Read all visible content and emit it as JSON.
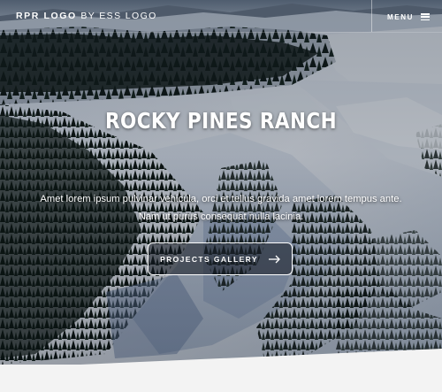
{
  "header": {
    "logo_bold": "RPR LOGO",
    "logo_light": "BY ESS LOGO",
    "menu_label": "MENU"
  },
  "hero": {
    "title": "ROCKY PINES RANCH",
    "lede_line1": "Amet lorem ipsum pulvinar vehicula, orci et tellus gravida amet lorem tempus ante.",
    "lede_line2": "Nam ut purus consequat nulla lacinia.",
    "cta_label": "PROJECTS GALLERY"
  },
  "icons": {
    "menu": "hamburger-icon",
    "cta": "arrow-right-icon"
  },
  "colors": {
    "text": "#ffffff",
    "snow": "#dfe6ef",
    "forest": "#0f1a14",
    "band": "#f3f3f3"
  }
}
